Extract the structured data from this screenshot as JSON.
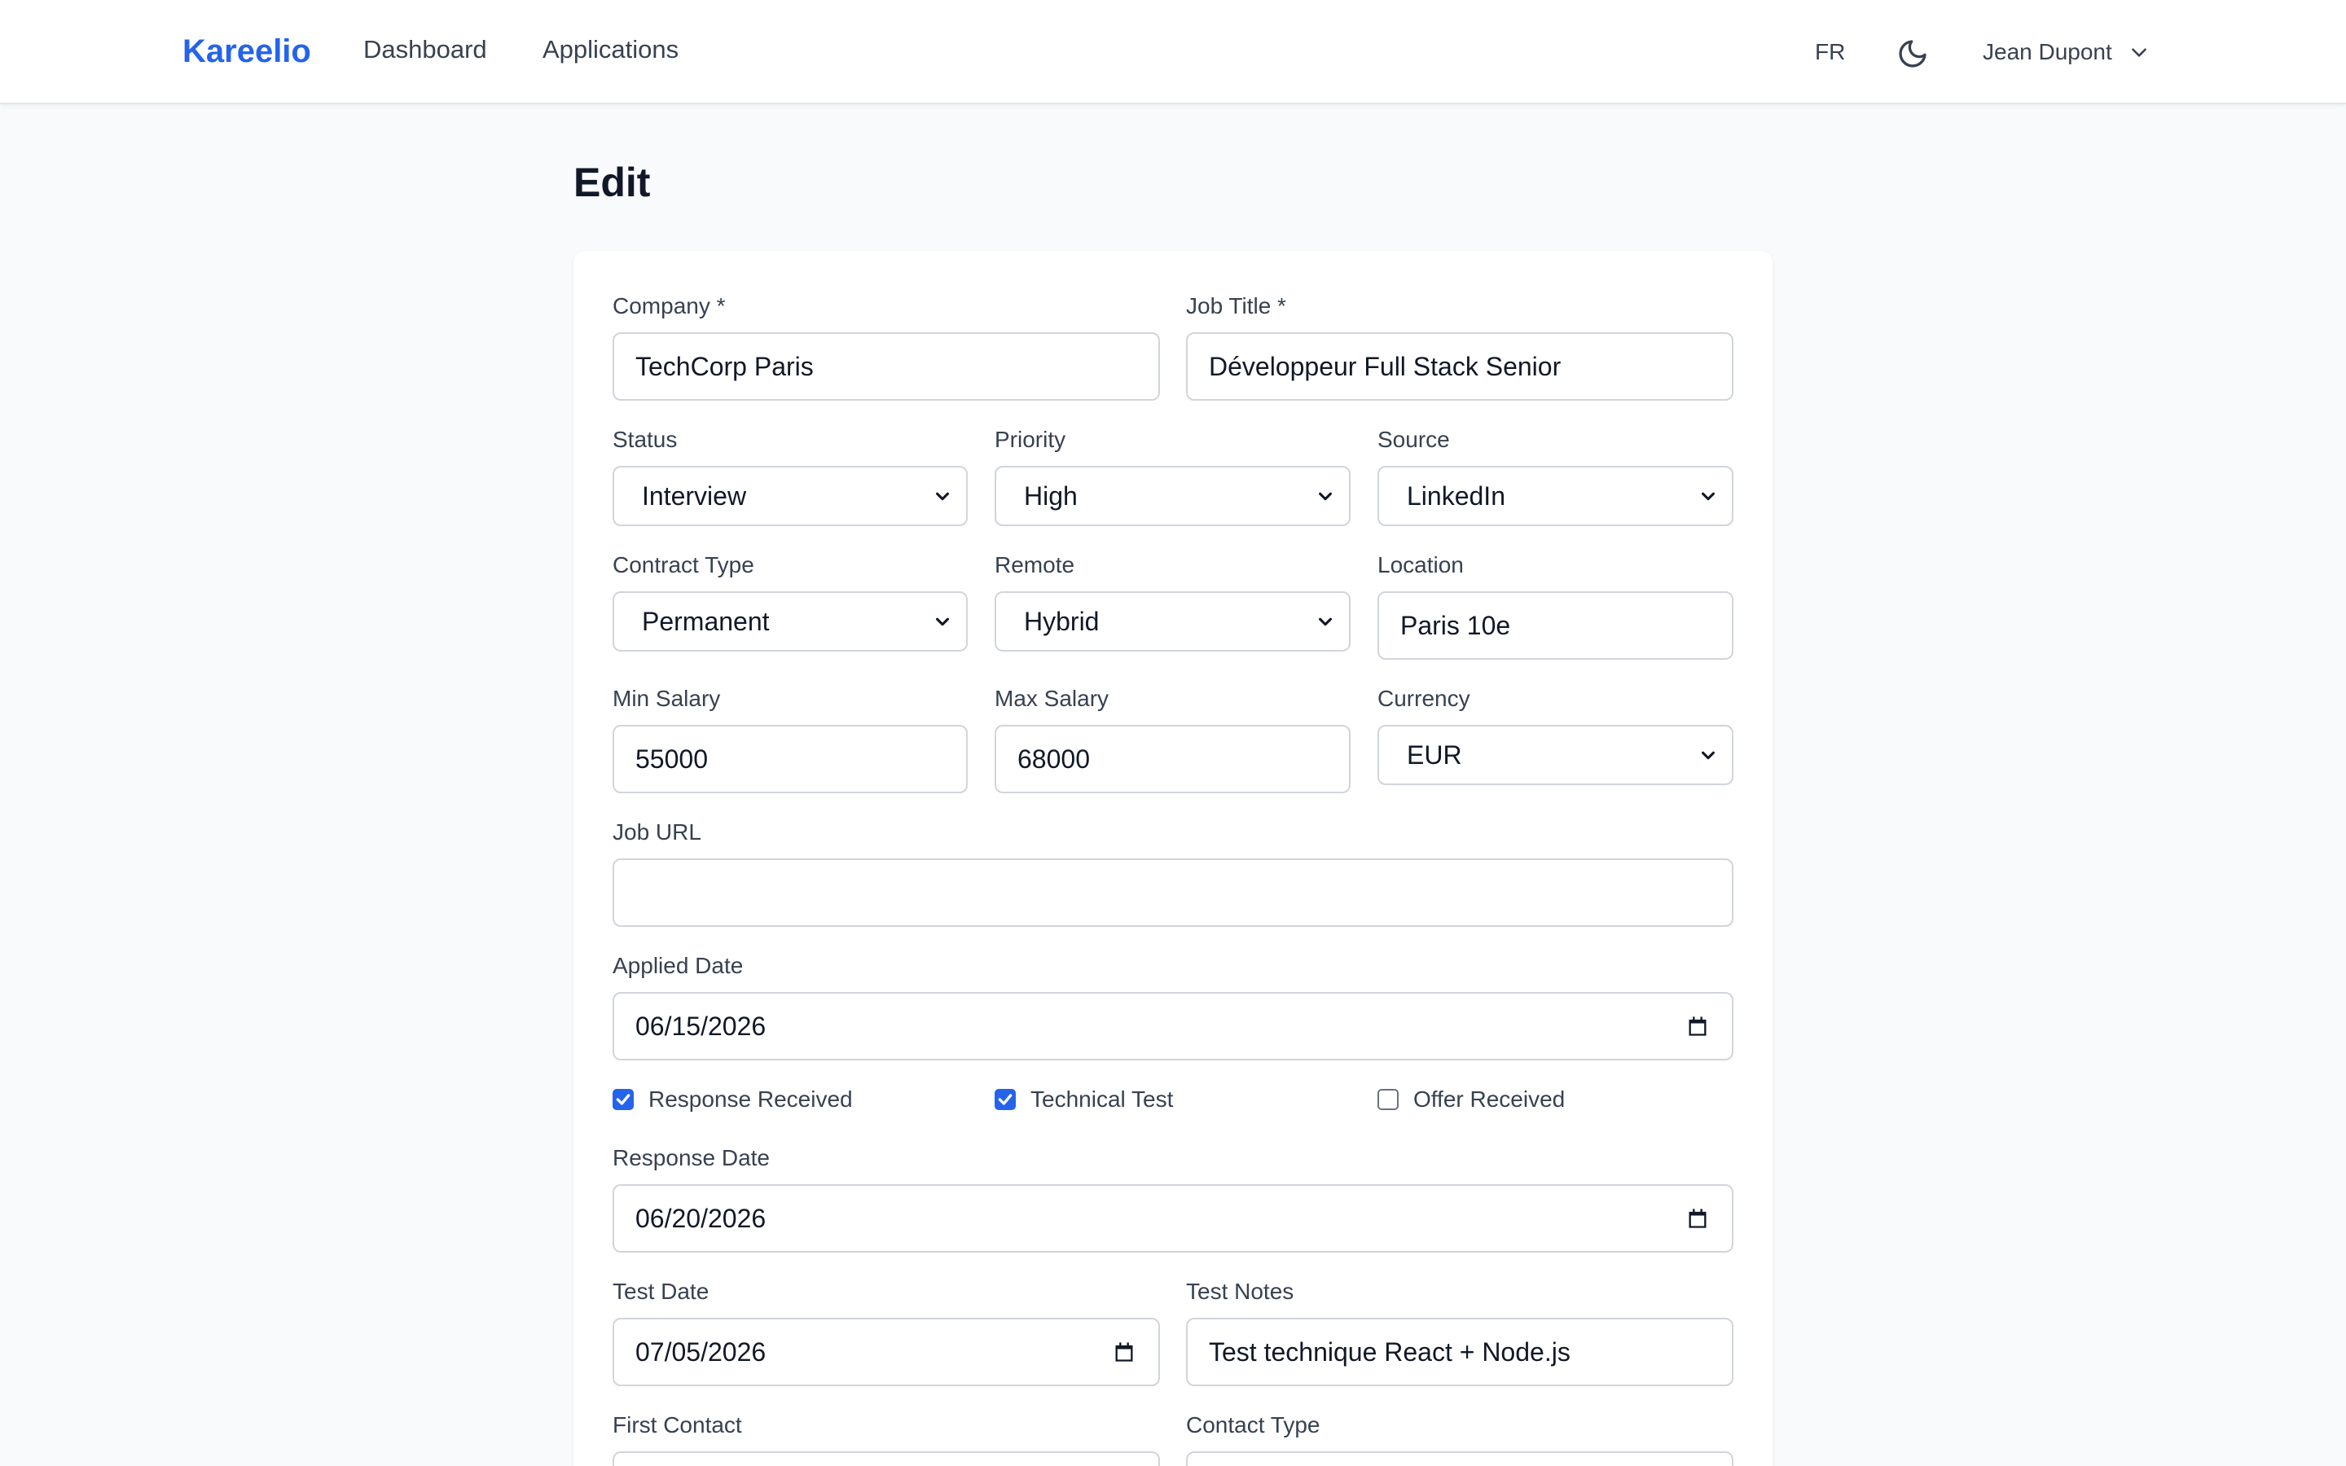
{
  "nav": {
    "brand": "Kareelio",
    "links": [
      "Dashboard",
      "Applications"
    ],
    "lang": "FR",
    "user": "Jean Dupont"
  },
  "page": {
    "title": "Edit"
  },
  "form": {
    "company": {
      "label": "Company *",
      "value": "TechCorp Paris"
    },
    "job_title": {
      "label": "Job Title *",
      "value": "Développeur Full Stack Senior"
    },
    "status": {
      "label": "Status",
      "value": "Interview"
    },
    "priority": {
      "label": "Priority",
      "value": "High"
    },
    "source": {
      "label": "Source",
      "value": "LinkedIn"
    },
    "contract_type": {
      "label": "Contract Type",
      "value": "Permanent"
    },
    "remote": {
      "label": "Remote",
      "value": "Hybrid"
    },
    "location": {
      "label": "Location",
      "value": "Paris 10e"
    },
    "min_salary": {
      "label": "Min Salary",
      "value": "55000"
    },
    "max_salary": {
      "label": "Max Salary",
      "value": "68000"
    },
    "currency": {
      "label": "Currency",
      "value": "EUR"
    },
    "job_url": {
      "label": "Job URL",
      "value": ""
    },
    "applied_date": {
      "label": "Applied Date",
      "value": "06/15/2026"
    },
    "checkboxes": [
      {
        "label": "Response Received",
        "checked": true
      },
      {
        "label": "Technical Test",
        "checked": true
      },
      {
        "label": "Offer Received",
        "checked": false
      }
    ],
    "response_date": {
      "label": "Response Date",
      "value": "06/20/2026"
    },
    "test_date": {
      "label": "Test Date",
      "value": "07/05/2026"
    },
    "test_notes": {
      "label": "Test Notes",
      "value": "Test technique React + Node.js"
    },
    "first_contact": {
      "label": "First Contact",
      "value": ""
    },
    "contact_type": {
      "label": "Contact Type",
      "value": ""
    }
  },
  "colors": {
    "accent": "#2563eb",
    "background": "#f9fafb",
    "card": "#ffffff",
    "border": "#d1d5db"
  },
  "icons": [
    "moon-icon",
    "chevron-down-icon",
    "calendar-icon",
    "check-icon"
  ]
}
